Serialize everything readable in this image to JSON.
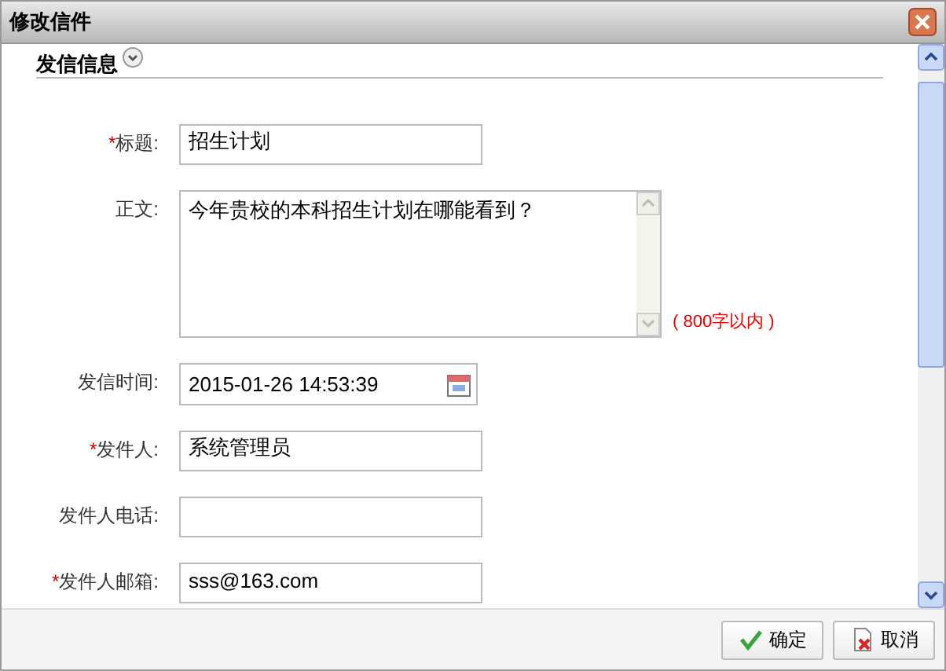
{
  "window": {
    "title": "修改信件"
  },
  "section": {
    "title": "发信信息",
    "expanded": true
  },
  "fields": [
    {
      "kind": "text",
      "marker": "*",
      "label": "标题:",
      "value": "招生计划"
    },
    {
      "kind": "textarea",
      "label": "正文:",
      "value": "今年贵校的本科招生计划在哪能看到？",
      "hint": "( 800字以内 )"
    },
    {
      "kind": "date",
      "label": "发信时间:",
      "value": "2015-01-26 14:53:39"
    },
    {
      "kind": "text",
      "marker": "*",
      "label": "发件人:",
      "value": "系统管理员"
    },
    {
      "kind": "text",
      "label": "发件人电话:"
    },
    {
      "kind": "text",
      "marker": "*",
      "label": "发件人邮箱:",
      "value": "sss@163.com"
    }
  ],
  "buttons": [
    {
      "kind": "ok",
      "label": "确定"
    },
    {
      "kind": "cancel",
      "label": "取消"
    }
  ]
}
